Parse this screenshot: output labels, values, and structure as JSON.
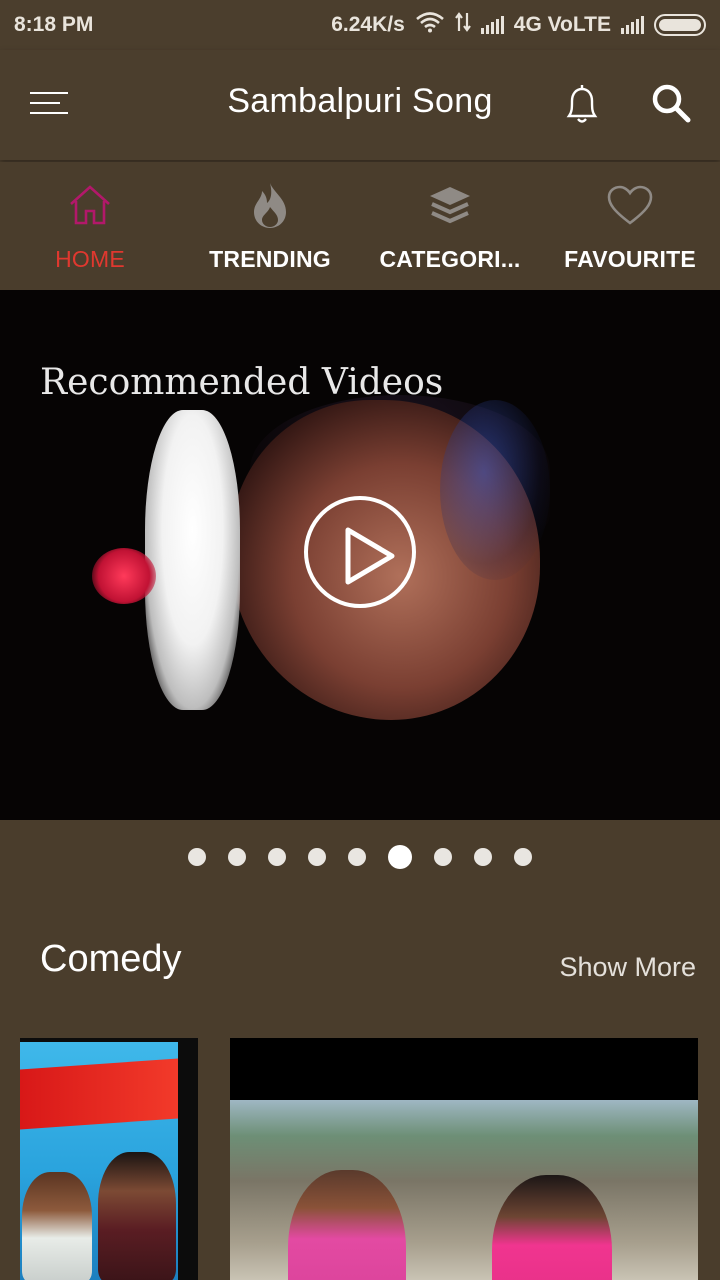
{
  "status_bar": {
    "time": "8:18 PM",
    "speed": "6.24K/s",
    "network": "4G VoLTE",
    "icons": [
      "wifi-icon",
      "data-arrows-icon",
      "signal-icon",
      "signal-icon",
      "battery-icon"
    ]
  },
  "app_bar": {
    "title": "Sambalpuri Song",
    "icons": [
      "menu-icon",
      "bell-icon",
      "search-icon"
    ]
  },
  "tabs": [
    {
      "label": "HOME",
      "icon": "home-icon",
      "active": true,
      "color": "#e0382f"
    },
    {
      "label": "TRENDING",
      "icon": "flame-icon",
      "active": false
    },
    {
      "label": "CATEGORI...",
      "icon": "layers-icon",
      "active": false
    },
    {
      "label": "FAVOURITE",
      "icon": "heart-icon",
      "active": false
    }
  ],
  "banner": {
    "title": "Recommended Videos",
    "icon": "play-icon",
    "slide_count": 9,
    "active_slide": 6
  },
  "section": {
    "title": "Comedy",
    "show_more": "Show More"
  },
  "colors": {
    "background": "#4a3d2c",
    "active_tab": "#e0382f",
    "home_icon": "#b2186a"
  }
}
